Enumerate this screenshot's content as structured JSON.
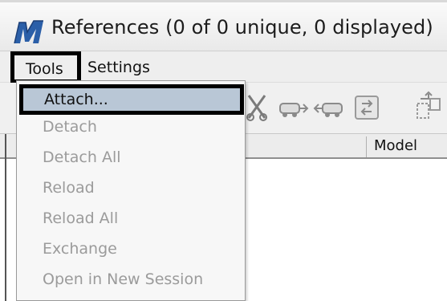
{
  "window": {
    "title": "References (0 of 0 unique, 0 displayed)",
    "app_icon": "microstation-icon"
  },
  "menubar": {
    "tools": {
      "label": "Tools",
      "mnemonic_index": 0,
      "open": true
    },
    "settings": {
      "label": "Settings",
      "mnemonic_index": 0
    }
  },
  "toolbar": {
    "icons": [
      "detach-icon",
      "reload-icon",
      "reload-all-icon",
      "exchange-icon",
      "open-session-icon"
    ]
  },
  "table": {
    "columns": [
      {
        "label": "Model"
      }
    ]
  },
  "tools_menu": {
    "items": [
      {
        "label": "Attach...",
        "enabled": true,
        "highlighted": true
      },
      {
        "label": "Detach",
        "enabled": false
      },
      {
        "label": "Detach All",
        "enabled": false
      },
      {
        "label": "Reload",
        "enabled": false
      },
      {
        "label": "Reload All",
        "enabled": false
      },
      {
        "label": "Exchange",
        "enabled": false
      },
      {
        "label": "Open in New Session",
        "enabled": false
      }
    ]
  },
  "colors": {
    "highlight_bg": "#b9c7d6",
    "disabled_text": "#9b9b9b",
    "callout_border": "#000000"
  }
}
